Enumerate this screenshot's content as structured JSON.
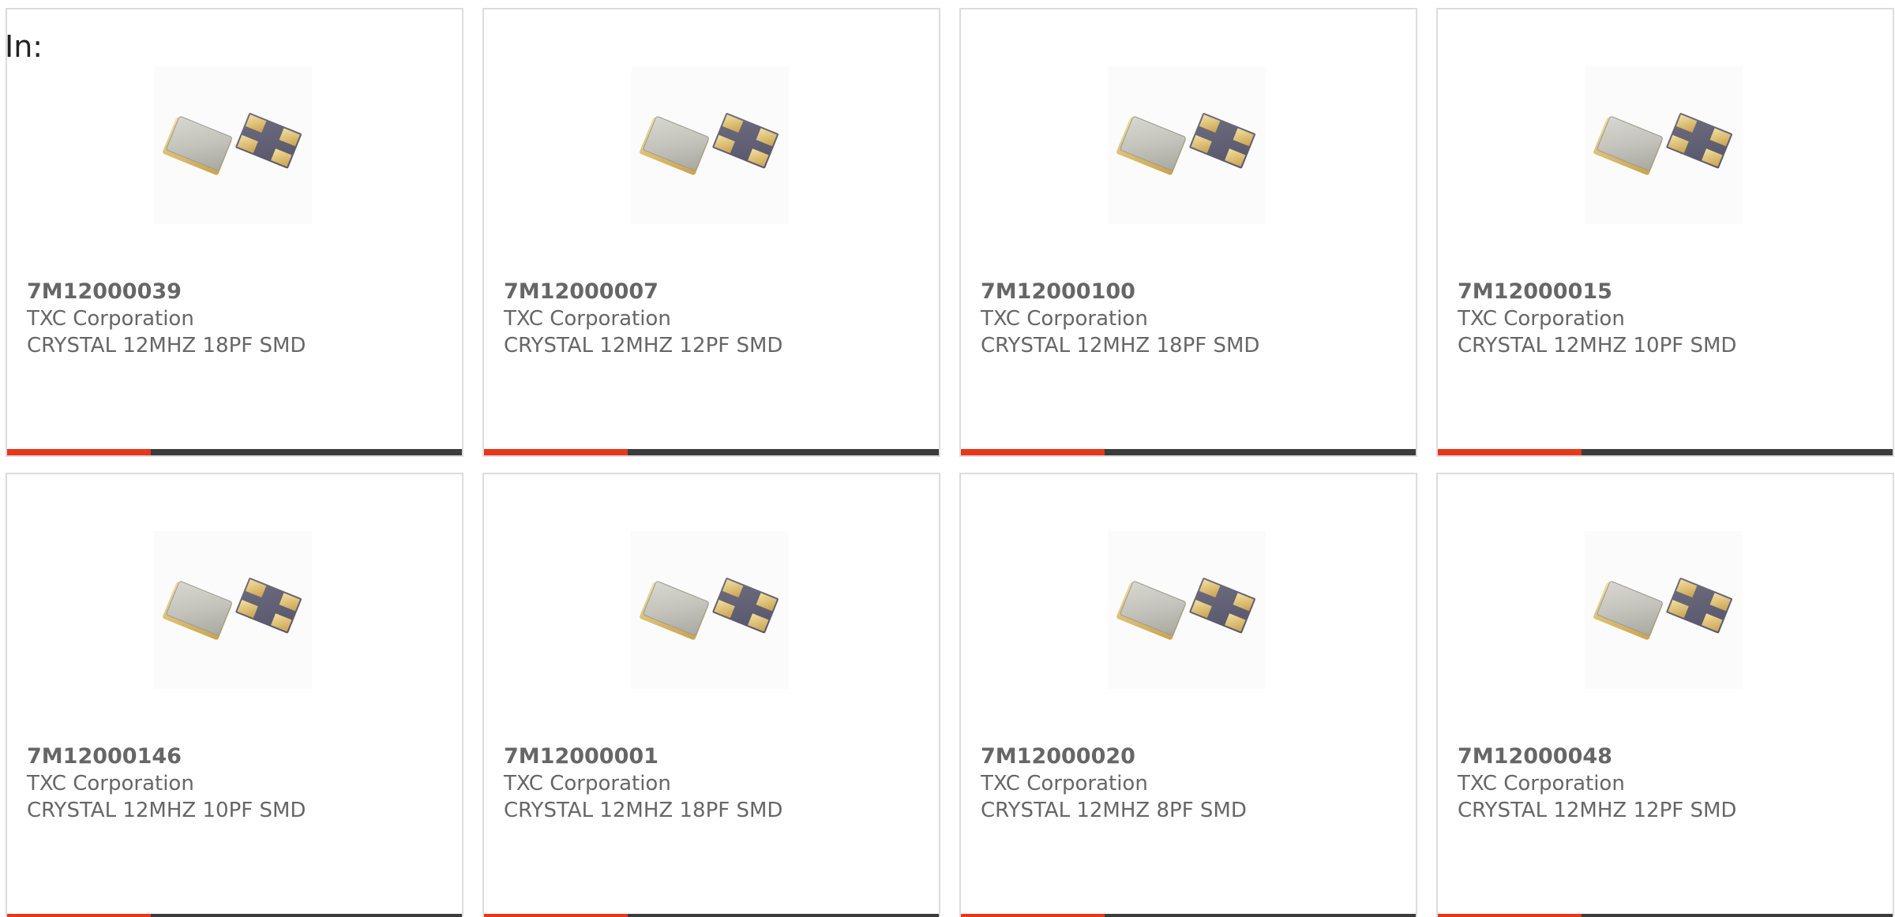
{
  "header": {
    "in_label": "In:"
  },
  "accent_color": "#e8371a",
  "bar_color": "#3c3c3c",
  "products": [
    {
      "part_number": "7M12000039",
      "manufacturer": "TXC Corporation",
      "description": "CRYSTAL 12MHZ 18PF SMD",
      "image_icon": "crystal-smd-icon"
    },
    {
      "part_number": "7M12000007",
      "manufacturer": "TXC Corporation",
      "description": "CRYSTAL 12MHZ 12PF SMD",
      "image_icon": "crystal-smd-icon"
    },
    {
      "part_number": "7M12000100",
      "manufacturer": "TXC Corporation",
      "description": "CRYSTAL 12MHZ 18PF SMD",
      "image_icon": "crystal-smd-icon"
    },
    {
      "part_number": "7M12000015",
      "manufacturer": "TXC Corporation",
      "description": "CRYSTAL 12MHZ 10PF SMD",
      "image_icon": "crystal-smd-icon"
    },
    {
      "part_number": "7M12000146",
      "manufacturer": "TXC Corporation",
      "description": "CRYSTAL 12MHZ 10PF SMD",
      "image_icon": "crystal-smd-icon"
    },
    {
      "part_number": "7M12000001",
      "manufacturer": "TXC Corporation",
      "description": "CRYSTAL 12MHZ 18PF SMD",
      "image_icon": "crystal-smd-icon"
    },
    {
      "part_number": "7M12000020",
      "manufacturer": "TXC Corporation",
      "description": "CRYSTAL 12MHZ 8PF SMD",
      "image_icon": "crystal-smd-icon"
    },
    {
      "part_number": "7M12000048",
      "manufacturer": "TXC Corporation",
      "description": "CRYSTAL 12MHZ 12PF SMD",
      "image_icon": "crystal-smd-icon"
    }
  ]
}
